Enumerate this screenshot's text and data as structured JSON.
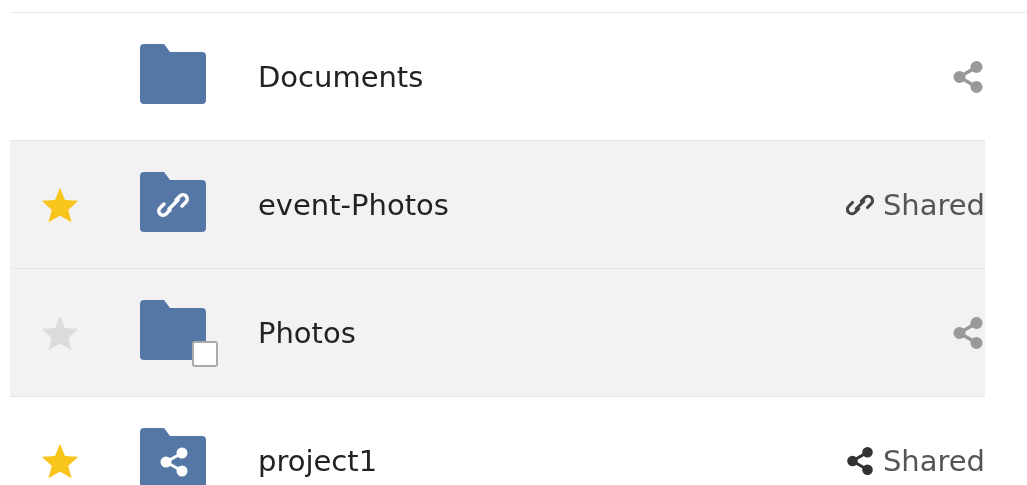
{
  "files": [
    {
      "name": "Documents",
      "kind": "plain",
      "favorite": false,
      "hovered": false,
      "highlighted": false,
      "share": {
        "kind": "none"
      }
    },
    {
      "name": "event-Photos",
      "kind": "link",
      "favorite": true,
      "hovered": false,
      "highlighted": true,
      "share": {
        "kind": "link",
        "label": "Shared"
      }
    },
    {
      "name": "Photos",
      "kind": "plain",
      "favorite": false,
      "hovered": true,
      "highlighted": true,
      "share": {
        "kind": "none"
      }
    },
    {
      "name": "project1",
      "kind": "shared",
      "favorite": true,
      "hovered": false,
      "highlighted": false,
      "share": {
        "kind": "shared",
        "label": "Shared"
      }
    }
  ]
}
